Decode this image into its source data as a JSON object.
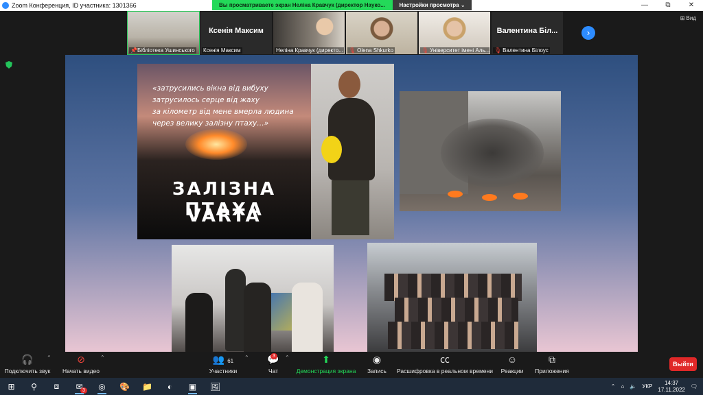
{
  "titlebar": {
    "title": "Zoom Конференция, ID участника: 1301366",
    "minimize": "—",
    "maximize": "⧉",
    "close": "✕"
  },
  "banner": {
    "message": "Вы просматриваете экран Неліна Кравчук (директор Науко...",
    "options": "Настройки просмотра ⌄"
  },
  "view_button": "⊞ Вид",
  "participants": [
    {
      "name": "Бібліотека Ушинського",
      "display": "",
      "muted": false,
      "pinned": true
    },
    {
      "name": "Ксенія Максим",
      "display": "Ксенія Максим",
      "muted": false
    },
    {
      "name": "Неліна Кравчук (директо...",
      "display": "",
      "muted": false
    },
    {
      "name": "Olena Shkurko",
      "display": "",
      "muted": true
    },
    {
      "name": "Університет імені Аль...",
      "display": "",
      "muted": true
    },
    {
      "name": "Валентина  Білоус",
      "display": "Валентина   Біл...",
      "muted": true
    }
  ],
  "slide": {
    "quote_lines": [
      "«затрусились вікна від вибуху",
      "затрусилось серце від жаху",
      "за кілометр від мене вмерла людина",
      "через велику залізну птаху…»"
    ],
    "poster_title": "ЗАЛІЗНА ПТАХА",
    "poster_artist": "VARTA"
  },
  "toolbar": {
    "audio": "Подключить звук",
    "video": "Начать видео",
    "participants": "Участники",
    "participants_count": "61",
    "chat": "Чат",
    "chat_badge": "3",
    "share": "Демонстрация экрана",
    "record": "Запись",
    "captions": "Расшифровка в реальном времени",
    "reactions": "Реакции",
    "apps": "Приложения",
    "leave": "Выйти"
  },
  "taskbar": {
    "mail_badge": "3",
    "language": "УКР",
    "time": "14:37",
    "date": "17.11.2022"
  },
  "colors": {
    "zoom_blue": "#2d8cff",
    "share_green": "#23d959",
    "leave_red": "#e02828"
  }
}
